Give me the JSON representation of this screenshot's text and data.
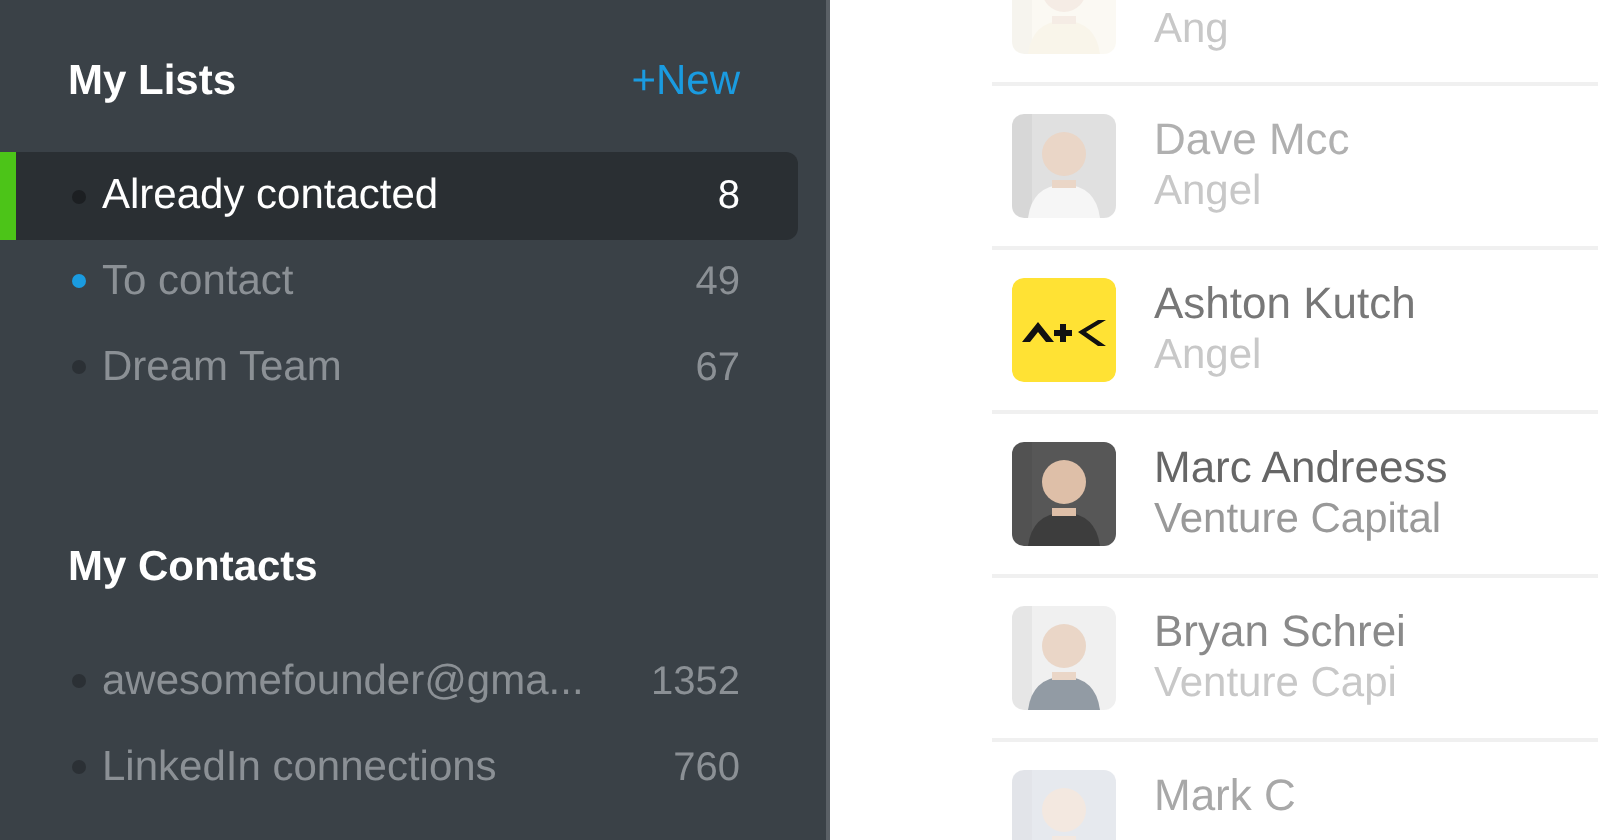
{
  "sidebar": {
    "lists_section": {
      "title": "My Lists",
      "new_link": "+New",
      "items": [
        {
          "label": "Already contacted",
          "count": "8",
          "selected": true,
          "color": "#1c1f22"
        },
        {
          "label": "To contact",
          "count": "49",
          "selected": false,
          "color": "#1a9be0"
        },
        {
          "label": "Dream Team",
          "count": "67",
          "selected": false,
          "color": "#2b3035"
        }
      ]
    },
    "contacts_section": {
      "title": "My Contacts",
      "items": [
        {
          "label": "awesomefounder@gma...",
          "count": "1352",
          "selected": false,
          "color": "#2b3035"
        },
        {
          "label": "LinkedIn connections",
          "count": "760",
          "selected": false,
          "color": "#2b3035"
        }
      ]
    }
  },
  "people": [
    {
      "role": "Ang",
      "kind": "picture"
    },
    {
      "name": "Dave Mcc",
      "role": "Angel",
      "kind": "picture"
    },
    {
      "name": "Ashton Kutch",
      "role": "Angel",
      "kind": "logo"
    },
    {
      "name": "Marc Andreess",
      "role": "Venture Capital",
      "kind": "picture"
    },
    {
      "name": "Bryan Schrei",
      "role": "Venture Capi",
      "kind": "picture"
    },
    {
      "name": "Mark C",
      "kind": "picture"
    }
  ]
}
